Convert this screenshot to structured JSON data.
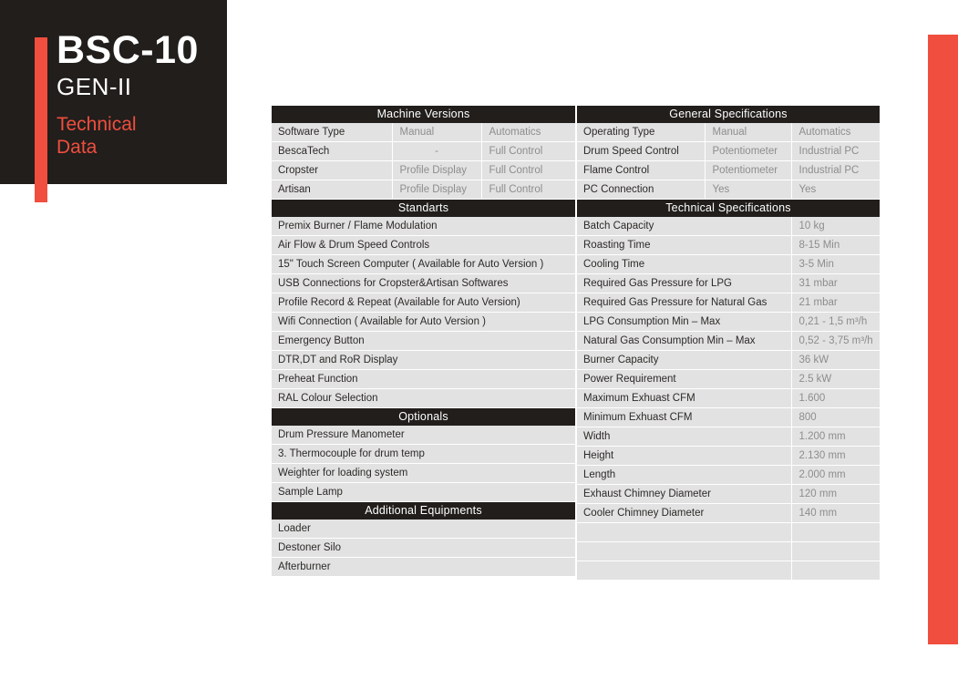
{
  "title_panel": {
    "model": "BSC-10",
    "generation": "GEN-II",
    "subtitle": "Technical\nData",
    "accent_color": "#f04e3e",
    "panel_color": "#211e1c"
  },
  "left_table": {
    "sections": [
      {
        "header": "Machine Versions",
        "layout": "three-column",
        "rows": [
          {
            "label": "Software Type",
            "manual": "Manual",
            "automatic": "Automatics"
          },
          {
            "label": "BescaTech",
            "manual": "-",
            "automatic": "Full Control"
          },
          {
            "label": "Cropster",
            "manual": "Profile Display",
            "automatic": "Full Control"
          },
          {
            "label": "Artisan",
            "manual": "Profile Display",
            "automatic": "Full Control"
          }
        ]
      },
      {
        "header": "Standarts",
        "layout": "single-column",
        "rows": [
          {
            "label": "Premix Burner / Flame Modulation"
          },
          {
            "label": "Air Flow & Drum Speed Controls"
          },
          {
            "label": "15\" Touch Screen Computer ( Available for Auto Version )"
          },
          {
            "label": "USB Connections for Cropster&Artisan Softwares"
          },
          {
            "label": "Profile Record & Repeat (Available for Auto Version)"
          },
          {
            "label": "Wifi Connection ( Available for Auto Version )"
          },
          {
            "label": "Emergency Button"
          },
          {
            "label": "DTR,DT and RoR Display"
          },
          {
            "label": "Preheat Function"
          },
          {
            "label": "RAL Colour Selection"
          }
        ]
      },
      {
        "header": "Optionals",
        "layout": "single-column",
        "rows": [
          {
            "label": "Drum Pressure Manometer"
          },
          {
            "label": "3. Thermocouple for drum temp"
          },
          {
            "label": "Weighter for loading system"
          },
          {
            "label": "Sample Lamp"
          }
        ]
      },
      {
        "header": "Additional Equipments",
        "layout": "single-column",
        "rows": [
          {
            "label": "Loader"
          },
          {
            "label": "Destoner Silo"
          },
          {
            "label": "Afterburner"
          }
        ]
      }
    ]
  },
  "right_table": {
    "sections": [
      {
        "header": "General Specifications",
        "layout": "three-column",
        "rows": [
          {
            "label": "Operating Type",
            "manual": "Manual",
            "automatic": "Automatics"
          },
          {
            "label": "Drum Speed Control",
            "manual": "Potentiometer",
            "automatic": "Industrial PC"
          },
          {
            "label": "Flame Control",
            "manual": "Potentiometer",
            "automatic": "Industrial PC"
          },
          {
            "label": "PC Connection",
            "manual": "Yes",
            "automatic": "Yes"
          }
        ]
      },
      {
        "header": "Technical Specifications",
        "layout": "two-column",
        "rows": [
          {
            "label": "Batch Capacity",
            "value": "10 kg"
          },
          {
            "label": "Roasting Time",
            "value": "8-15 Min"
          },
          {
            "label": "Cooling Time",
            "value": "3-5 Min"
          },
          {
            "label": "Required Gas Pressure for LPG",
            "value": "31 mbar"
          },
          {
            "label": "Required Gas Pressure for  Natural Gas",
            "value": "21 mbar"
          },
          {
            "label": "LPG Consumption Min – Max",
            "value": "0,21 - 1,5 m³/h"
          },
          {
            "label": "Natural Gas Consumption Min – Max",
            "value": "0,52 - 3,75 m³/h"
          },
          {
            "label": "Burner Capacity",
            "value": "36 kW"
          },
          {
            "label": "Power Requirement",
            "value": "2.5 kW"
          },
          {
            "label": "Maximum Exhuast CFM",
            "value": "1.600"
          },
          {
            "label": "Minimum Exhuast CFM",
            "value": "800"
          },
          {
            "label": "Width",
            "value": "1.200 mm"
          },
          {
            "label": "Height",
            "value": "2.130 mm"
          },
          {
            "label": "Length",
            "value": "2.000 mm"
          },
          {
            "label": "Exhaust Chimney Diameter",
            "value": "120 mm"
          },
          {
            "label": "Cooler Chimney Diameter",
            "value": "140 mm"
          },
          {
            "label": "",
            "value": ""
          },
          {
            "label": "",
            "value": ""
          },
          {
            "label": "",
            "value": ""
          }
        ]
      }
    ]
  }
}
